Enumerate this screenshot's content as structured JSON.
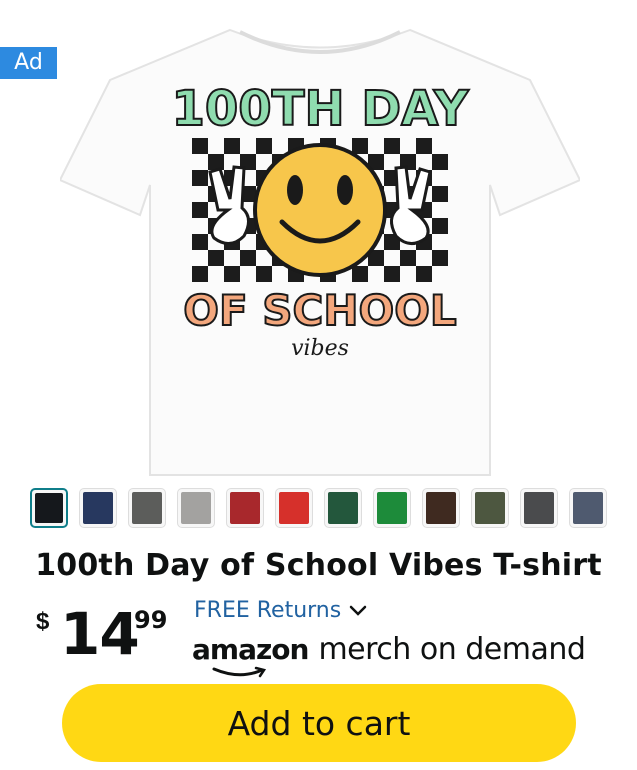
{
  "ad_label": "Ad",
  "product": {
    "title": "100th Day of School Vibes T-shirt",
    "image_icon": "t-shirt-product-image",
    "graphic_text": {
      "line1": "100TH DAY",
      "line2": "OF SCHOOL",
      "line3": "vibes"
    }
  },
  "swatches": [
    {
      "name": "black",
      "color": "#15181c",
      "selected": true
    },
    {
      "name": "navy",
      "color": "#27385f"
    },
    {
      "name": "charcoal-gray",
      "color": "#5c5d5b"
    },
    {
      "name": "light-gray",
      "color": "#a3a2a0"
    },
    {
      "name": "dark-red",
      "color": "#a8282c"
    },
    {
      "name": "red",
      "color": "#d6302b"
    },
    {
      "name": "dark-green",
      "color": "#23573c"
    },
    {
      "name": "green",
      "color": "#1d8b3a"
    },
    {
      "name": "brown",
      "color": "#3f2a20"
    },
    {
      "name": "olive",
      "color": "#4d5740"
    },
    {
      "name": "dark-heather",
      "color": "#4a4b4d"
    },
    {
      "name": "slate",
      "color": "#4f5a6f"
    }
  ],
  "price": {
    "currency": "$",
    "whole": "14",
    "fraction": "99"
  },
  "returns": {
    "label": "FREE Returns",
    "icon": "chevron-down-icon"
  },
  "merch": {
    "brand": "amazon",
    "text": "merch on demand"
  },
  "cart_button": {
    "label": "Add to cart",
    "color": "#ffd814"
  },
  "colors": {
    "ad_badge": "#2d8ae0",
    "link": "#2162a1",
    "selected_swatch_border": "#0f7e8a"
  }
}
